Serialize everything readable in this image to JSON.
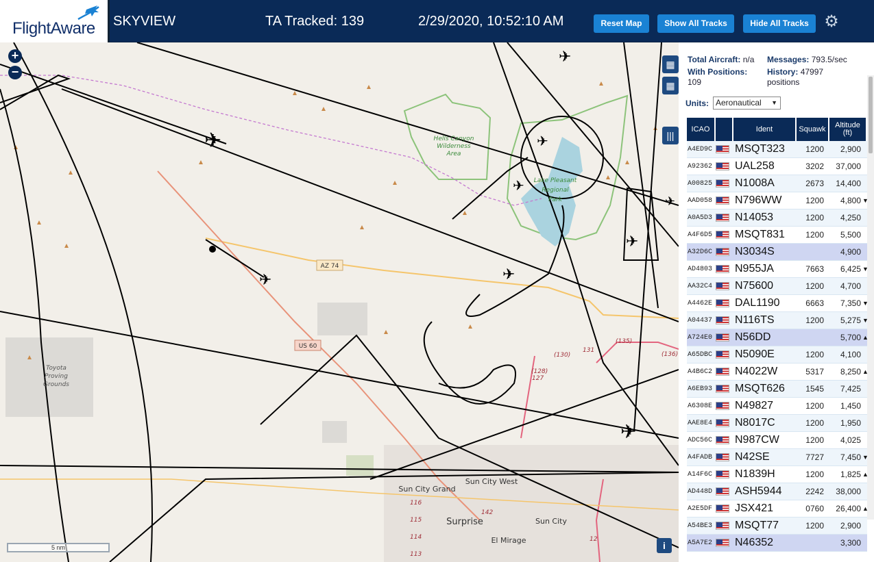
{
  "header": {
    "logo_text": "FlightAware",
    "site_name": "SKYVIEW",
    "tracked": "TA Tracked: 139",
    "clock": "2/29/2020, 10:52:10 AM",
    "reset_label": "Reset Map",
    "show_all_label": "Show All Tracks",
    "hide_all_label": "Hide All Tracks",
    "settings_icon": "gear-icon"
  },
  "map": {
    "zoom_in": "+",
    "zoom_out": "−",
    "scale_label": "5 nm",
    "labels": {
      "hells_canyon": [
        "Hells Canyon",
        "Wilderness",
        "Area"
      ],
      "lake_pleasant": [
        "Lake Pleasant",
        "Regional",
        "Park"
      ],
      "toyota": [
        "Toyota",
        "Proving",
        "Grounds"
      ],
      "az74": "AZ 74",
      "us60": "US 60",
      "sun_city_grand": "Sun City Grand",
      "sun_city_west": "Sun City West",
      "sun_city": "Sun City",
      "surprise": "Surprise",
      "el_mirage": "El Mirage",
      "r135": "(135)",
      "r136": "(136)",
      "r130": "(130)",
      "r131": "131",
      "r128": "(128)",
      "r127": "127",
      "r116": "116",
      "r115": "115",
      "r114": "114",
      "r113": "113",
      "r142": "142",
      "r12": "12"
    },
    "colors": {
      "background": "#f2efe9",
      "water": "#aad3df",
      "park_border": "#8cc37a",
      "highway": "#e8937a",
      "road": "#f5c56b",
      "track": "#000000"
    }
  },
  "stats": {
    "total_label": "Total Aircraft:",
    "total_value": "n/a",
    "messages_label": "Messages:",
    "messages_value": "793.5/sec",
    "positions_label": "With Positions:",
    "positions_value": "109",
    "history_label": "History:",
    "history_value": "47997",
    "history_unit": "positions",
    "units_label": "Units:",
    "units_value": "Aeronautical"
  },
  "table": {
    "headers": [
      "ICAO",
      "",
      "Ident",
      "Squawk",
      "Altitude (ft)"
    ],
    "rows": [
      {
        "icao": "A4ED9C",
        "ident": "MSQT323",
        "squawk": "1200",
        "alt": "2,900",
        "trend": ""
      },
      {
        "icao": "A92362",
        "ident": "UAL258",
        "squawk": "3202",
        "alt": "37,000",
        "trend": ""
      },
      {
        "icao": "A00825",
        "ident": "N1008A",
        "squawk": "2673",
        "alt": "14,400",
        "trend": ""
      },
      {
        "icao": "AAD058",
        "ident": "N796WW",
        "squawk": "1200",
        "alt": "4,800",
        "trend": "▼"
      },
      {
        "icao": "A0A5D3",
        "ident": "N14053",
        "squawk": "1200",
        "alt": "4,250",
        "trend": ""
      },
      {
        "icao": "A4F6D5",
        "ident": "MSQT831",
        "squawk": "1200",
        "alt": "5,500",
        "trend": ""
      },
      {
        "icao": "A32D6C",
        "ident": "N3034S",
        "squawk": "",
        "alt": "4,900",
        "trend": ""
      },
      {
        "icao": "AD4803",
        "ident": "N955JA",
        "squawk": "7663",
        "alt": "6,425",
        "trend": "▼"
      },
      {
        "icao": "AA32C4",
        "ident": "N75600",
        "squawk": "1200",
        "alt": "4,700",
        "trend": ""
      },
      {
        "icao": "A4462E",
        "ident": "DAL1190",
        "squawk": "6663",
        "alt": "7,350",
        "trend": "▼"
      },
      {
        "icao": "A04437",
        "ident": "N116TS",
        "squawk": "1200",
        "alt": "5,275",
        "trend": "▼"
      },
      {
        "icao": "A724E0",
        "ident": "N56DD",
        "squawk": "",
        "alt": "5,700",
        "trend": "▲"
      },
      {
        "icao": "A65DBC",
        "ident": "N5090E",
        "squawk": "1200",
        "alt": "4,100",
        "trend": ""
      },
      {
        "icao": "A4B6C2",
        "ident": "N4022W",
        "squawk": "5317",
        "alt": "8,250",
        "trend": "▲"
      },
      {
        "icao": "A6EB93",
        "ident": "MSQT626",
        "squawk": "1545",
        "alt": "7,425",
        "trend": ""
      },
      {
        "icao": "A6308E",
        "ident": "N49827",
        "squawk": "1200",
        "alt": "1,450",
        "trend": ""
      },
      {
        "icao": "AAE8E4",
        "ident": "N8017C",
        "squawk": "1200",
        "alt": "1,950",
        "trend": ""
      },
      {
        "icao": "ADC56C",
        "ident": "N987CW",
        "squawk": "1200",
        "alt": "4,025",
        "trend": ""
      },
      {
        "icao": "A4FADB",
        "ident": "N42SE",
        "squawk": "7727",
        "alt": "7,450",
        "trend": "▼"
      },
      {
        "icao": "A14F6C",
        "ident": "N1839H",
        "squawk": "1200",
        "alt": "1,825",
        "trend": "▲"
      },
      {
        "icao": "AD448D",
        "ident": "ASH5944",
        "squawk": "2242",
        "alt": "38,000",
        "trend": ""
      },
      {
        "icao": "A2E5DF",
        "ident": "JSX421",
        "squawk": "0760",
        "alt": "26,400",
        "trend": "▲"
      },
      {
        "icao": "A54BE3",
        "ident": "MSQT77",
        "squawk": "1200",
        "alt": "2,900",
        "trend": ""
      },
      {
        "icao": "A5A7E2",
        "ident": "N46352",
        "squawk": "",
        "alt": "3,300",
        "trend": ""
      }
    ]
  }
}
